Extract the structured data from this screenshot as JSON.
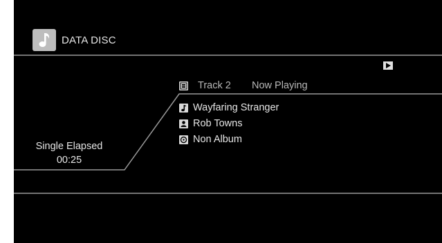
{
  "header": {
    "source_icon": "music-note-icon",
    "source_label": "DATA DISC"
  },
  "transport": {
    "state_icon": "play-icon"
  },
  "track": {
    "icon": "track-icon",
    "label": "Track 2",
    "status": "Now Playing"
  },
  "metadata": [
    {
      "icon": "music-note-icon",
      "text": "Wayfaring Stranger"
    },
    {
      "icon": "artist-icon",
      "text": "Rob Towns"
    },
    {
      "icon": "album-icon",
      "text": "Non Album"
    }
  ],
  "elapsed": {
    "label": "Single Elapsed",
    "time": "00:25"
  },
  "colors": {
    "background": "#000000",
    "text": "#e6e6e6",
    "divider": "#9a9a9a",
    "icon_fill": "#bdbdbd"
  }
}
